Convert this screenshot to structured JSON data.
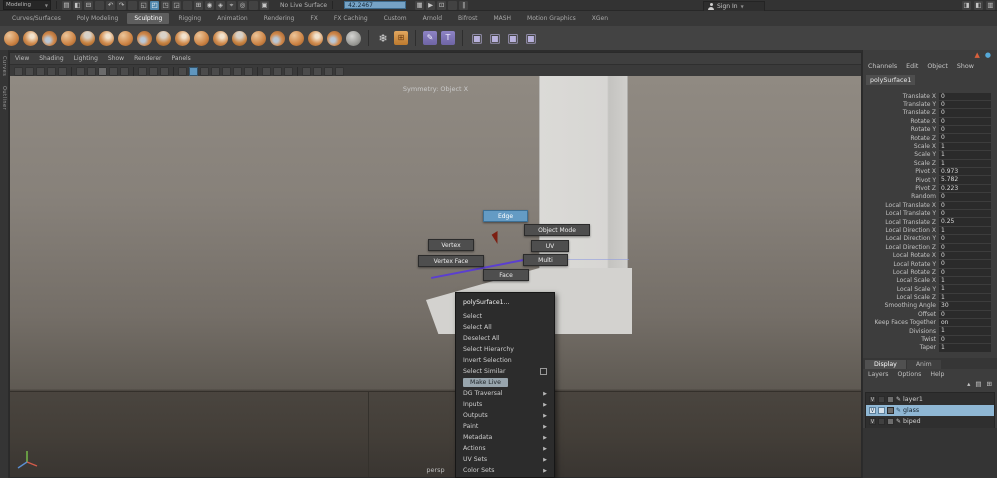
{
  "colors": {
    "accent_blue": "#5f96bf",
    "clay_orange": "#cf8a4e",
    "selection_blue": "#8fb7d4",
    "edge_purple": "#5b3fd0",
    "viewport_top": "#908a82",
    "viewport_bottom": "#393531"
  },
  "status_line": {
    "mode_selector": "Modeling",
    "live_surface_label": "No Live Surface",
    "numeric_input_value": "42.2467",
    "sign_in_label": "Sign In",
    "left_icons": [
      {
        "name": "new-scene-icon",
        "g": "▤"
      },
      {
        "name": "open-scene-icon",
        "g": "◧"
      },
      {
        "name": "save-scene-icon",
        "g": "⊟"
      },
      {
        "kind": "sep"
      },
      {
        "name": "undo-icon",
        "g": "↶"
      },
      {
        "name": "redo-icon",
        "g": "↷"
      },
      {
        "kind": "sep"
      },
      {
        "name": "select-mask-hierarchy-icon",
        "g": "◱"
      },
      {
        "name": "select-mask-object-icon",
        "g": "◰",
        "active": true
      },
      {
        "name": "select-mask-component-icon",
        "g": "◳"
      },
      {
        "name": "highlight-selection-icon",
        "g": "◲"
      },
      {
        "kind": "sep"
      },
      {
        "name": "snap-grid-icon",
        "g": "⊞"
      },
      {
        "name": "snap-curve-icon",
        "g": "◉"
      },
      {
        "name": "snap-point-icon",
        "g": "◈"
      },
      {
        "name": "snap-plane-icon",
        "g": "⌖"
      },
      {
        "name": "make-live-icon",
        "g": "◎"
      },
      {
        "kind": "sep"
      },
      {
        "name": "construction-history-icon",
        "g": "▣"
      }
    ],
    "render_icons": [
      {
        "name": "render-icon",
        "g": "▦"
      },
      {
        "name": "ipr-render-icon",
        "g": "▶"
      },
      {
        "name": "render-settings-icon",
        "g": "⊡"
      },
      {
        "kind": "sep"
      },
      {
        "name": "pause-icon",
        "g": "∥"
      }
    ],
    "right_icons": [
      {
        "name": "attribute-editor-toggle-icon",
        "g": "◨"
      },
      {
        "name": "tool-settings-toggle-icon",
        "g": "◧"
      },
      {
        "name": "channel-box-toggle-icon",
        "g": "▥"
      }
    ]
  },
  "shelf": {
    "tabs": [
      {
        "label": "Curves/Surfaces"
      },
      {
        "label": "Poly Modeling"
      },
      {
        "label": "Sculpting",
        "active": true
      },
      {
        "label": "Rigging"
      },
      {
        "label": "Animation"
      },
      {
        "label": "Rendering"
      },
      {
        "label": "FX"
      },
      {
        "label": "FX Caching"
      },
      {
        "label": "Custom"
      },
      {
        "label": "Arnold"
      },
      {
        "label": "Bifrost"
      },
      {
        "label": "MASH"
      },
      {
        "label": "Motion Graphics"
      },
      {
        "label": "XGen"
      }
    ],
    "icons": [
      {
        "name": "sculpt-tool-icon",
        "kind": "clay"
      },
      {
        "name": "smooth-tool-icon",
        "kind": "clayw"
      },
      {
        "name": "relax-tool-icon",
        "kind": "clayb"
      },
      {
        "name": "grab-tool-icon",
        "kind": "clay"
      },
      {
        "name": "pinch-tool-icon",
        "kind": "clayg"
      },
      {
        "name": "flatten-tool-icon",
        "kind": "clayw"
      },
      {
        "name": "foamy-tool-icon",
        "kind": "clay"
      },
      {
        "name": "spray-tool-icon",
        "kind": "clayb"
      },
      {
        "name": "repeat-tool-icon",
        "kind": "clayg"
      },
      {
        "name": "imprint-tool-icon",
        "kind": "clayw"
      },
      {
        "name": "wax-tool-icon",
        "kind": "clay"
      },
      {
        "name": "scrape-tool-icon",
        "kind": "clayw"
      },
      {
        "name": "fill-tool-icon",
        "kind": "clayg"
      },
      {
        "name": "knife-tool-icon",
        "kind": "clay"
      },
      {
        "name": "smear-tool-icon",
        "kind": "clayb"
      },
      {
        "name": "bulge-tool-icon",
        "kind": "clay"
      },
      {
        "name": "amplify-tool-icon",
        "kind": "clayw"
      },
      {
        "name": "freeze-tool-icon",
        "kind": "clayb"
      },
      {
        "name": "convert-to-frozen-icon",
        "kind": "claygray"
      },
      {
        "kind": "sep2"
      },
      {
        "name": "unfreeze-all-icon",
        "kind": "freeze",
        "g": "❄"
      },
      {
        "name": "sculpt-falloff-icon",
        "kind": "osq",
        "g": "⊞"
      },
      {
        "kind": "sep2"
      },
      {
        "name": "sculpt-mask-icon",
        "kind": "psq",
        "g": "✎"
      },
      {
        "name": "stamp-image-icon",
        "kind": "psqt",
        "g": "T"
      },
      {
        "kind": "sep2"
      },
      {
        "name": "mesh-cube-icon",
        "kind": "cube",
        "g": "▣"
      },
      {
        "name": "mesh-remesh-icon",
        "kind": "cube",
        "g": "▣"
      },
      {
        "name": "mesh-retopo-icon",
        "kind": "cube",
        "g": "▣"
      },
      {
        "name": "mesh-smooth-icon",
        "kind": "cube",
        "g": "▣"
      }
    ]
  },
  "left_dock": {
    "labels": [
      {
        "label": "Curves"
      },
      {
        "label": "Outliner"
      }
    ]
  },
  "viewport": {
    "menus": [
      {
        "label": "View"
      },
      {
        "label": "Shading"
      },
      {
        "label": "Lighting"
      },
      {
        "label": "Show"
      },
      {
        "label": "Renderer"
      },
      {
        "label": "Panels"
      }
    ],
    "toolbar_icons": [
      {
        "name": "select-camera-icon",
        "kind": "pt"
      },
      {
        "name": "lock-camera-icon",
        "kind": "pt"
      },
      {
        "name": "camera-attributes-icon",
        "kind": "pt"
      },
      {
        "name": "bookmark-icon",
        "kind": "pt"
      },
      {
        "name": "image-plane-icon",
        "kind": "pt"
      },
      {
        "kind": "ptsep"
      },
      {
        "name": "2d-pan-zoom-icon",
        "kind": "pt"
      },
      {
        "name": "grease-pencil-icon",
        "kind": "pt"
      },
      {
        "name": "grid-toggle-icon",
        "kind": "pt lit"
      },
      {
        "name": "film-gate-icon",
        "kind": "pt"
      },
      {
        "name": "resolution-gate-icon",
        "kind": "pt"
      },
      {
        "kind": "ptsep"
      },
      {
        "name": "gate-mask-icon",
        "kind": "pt"
      },
      {
        "name": "field-chart-icon",
        "kind": "pt"
      },
      {
        "name": "safe-action-icon",
        "kind": "pt"
      },
      {
        "kind": "ptsep"
      },
      {
        "name": "wireframe-icon",
        "kind": "pt"
      },
      {
        "name": "shaded-icon",
        "kind": "pt blue"
      },
      {
        "name": "textured-icon",
        "kind": "pt"
      },
      {
        "name": "lights-icon",
        "kind": "pt"
      },
      {
        "name": "shadows-icon",
        "kind": "pt"
      },
      {
        "name": "screen-space-ao-icon",
        "kind": "pt"
      },
      {
        "name": "motion-blur-icon",
        "kind": "pt"
      },
      {
        "kind": "ptsep"
      },
      {
        "name": "multisample-icon",
        "kind": "pt"
      },
      {
        "name": "xray-icon",
        "kind": "pt"
      },
      {
        "name": "isolate-select-icon",
        "kind": "pt"
      },
      {
        "kind": "ptsep"
      },
      {
        "name": "plugin-shelf-icon",
        "kind": "pt"
      },
      {
        "name": "viewcube-toggle-icon",
        "kind": "pt"
      },
      {
        "name": "exposure-icon",
        "kind": "pt"
      },
      {
        "name": "gamma-icon",
        "kind": "pt"
      }
    ],
    "symmetry_label": "Symmetry: Object X",
    "camera_label": "persp"
  },
  "marking_menu": {
    "items": [
      {
        "label": "Edge",
        "active": true
      },
      {
        "label": "Object Mode"
      },
      {
        "label": "Vertex"
      },
      {
        "label": "UV"
      },
      {
        "label": "Vertex Face"
      },
      {
        "label": "Multi"
      },
      {
        "label": "Face"
      }
    ]
  },
  "context_menu": {
    "items": [
      {
        "label": "polySurface1...",
        "type": "title"
      },
      {
        "label": "Select"
      },
      {
        "label": "Select All"
      },
      {
        "label": "Deselect All"
      },
      {
        "label": "Select Hierarchy"
      },
      {
        "label": "Invert Selection"
      },
      {
        "label": "Select Similar",
        "opt": true
      },
      {
        "label": "Make Live",
        "hl": true
      },
      {
        "label": "DG Traversal",
        "arrow": true
      },
      {
        "label": "Inputs",
        "arrow": true
      },
      {
        "label": "Outputs",
        "arrow": true
      },
      {
        "label": "Paint",
        "arrow": true
      },
      {
        "label": "Metadata",
        "arrow": true
      },
      {
        "label": "Actions",
        "arrow": true
      },
      {
        "label": "UV Sets",
        "arrow": true
      },
      {
        "label": "Color Sets",
        "arrow": true
      }
    ]
  },
  "channel_box": {
    "menus": [
      {
        "label": "Channels"
      },
      {
        "label": "Edit"
      },
      {
        "label": "Object"
      },
      {
        "label": "Show"
      }
    ],
    "object_name": "polySurface1",
    "rows": [
      {
        "label": "Translate X",
        "value": "0"
      },
      {
        "label": "Translate Y",
        "value": "0"
      },
      {
        "label": "Translate Z",
        "value": "0"
      },
      {
        "label": "Rotate X",
        "value": "0"
      },
      {
        "label": "Rotate Y",
        "value": "0"
      },
      {
        "label": "Rotate Z",
        "value": "0"
      },
      {
        "label": "Scale X",
        "value": "1"
      },
      {
        "label": "Scale Y",
        "value": "1"
      },
      {
        "label": "Scale Z",
        "value": "1"
      },
      {
        "label": "Pivot X",
        "value": "0.973"
      },
      {
        "label": "Pivot Y",
        "value": "5.782"
      },
      {
        "label": "Pivot Z",
        "value": "0.223"
      },
      {
        "label": "Random",
        "value": "0"
      },
      {
        "label": "Local Translate X",
        "value": "0"
      },
      {
        "label": "Local Translate Y",
        "value": "0"
      },
      {
        "label": "Local Translate Z",
        "value": "0.25"
      },
      {
        "label": "Local Direction X",
        "value": "1"
      },
      {
        "label": "Local Direction Y",
        "value": "0"
      },
      {
        "label": "Local Direction Z",
        "value": "0"
      },
      {
        "label": "Local Rotate X",
        "value": "0"
      },
      {
        "label": "Local Rotate Y",
        "value": "0"
      },
      {
        "label": "Local Rotate Z",
        "value": "0"
      },
      {
        "label": "Local Scale X",
        "value": "1"
      },
      {
        "label": "Local Scale Y",
        "value": "1"
      },
      {
        "label": "Local Scale Z",
        "value": "1"
      },
      {
        "label": "Smoothing Angle",
        "value": "30"
      },
      {
        "label": "Offset",
        "value": "0"
      },
      {
        "label": "Keep Faces Together",
        "value": "on"
      },
      {
        "label": "Divisions",
        "value": "1"
      },
      {
        "label": "Twist",
        "value": "0"
      },
      {
        "label": "Taper",
        "value": "1"
      }
    ]
  },
  "layer_editor": {
    "tabs": [
      {
        "label": "Display",
        "active": true
      },
      {
        "label": "Anim"
      }
    ],
    "menus": [
      {
        "label": "Layers"
      },
      {
        "label": "Options"
      },
      {
        "label": "Help"
      }
    ],
    "buttons": [
      {
        "name": "move-layer-up-icon",
        "g": "▴"
      },
      {
        "name": "new-empty-layer-icon",
        "g": "▤"
      },
      {
        "name": "new-layer-from-selected-icon",
        "g": "⊞"
      }
    ],
    "layers": [
      {
        "name": "layer1",
        "vis": "V"
      },
      {
        "name": "glass",
        "vis": "V",
        "selected": true
      },
      {
        "name": "biped",
        "vis": "V"
      }
    ]
  }
}
